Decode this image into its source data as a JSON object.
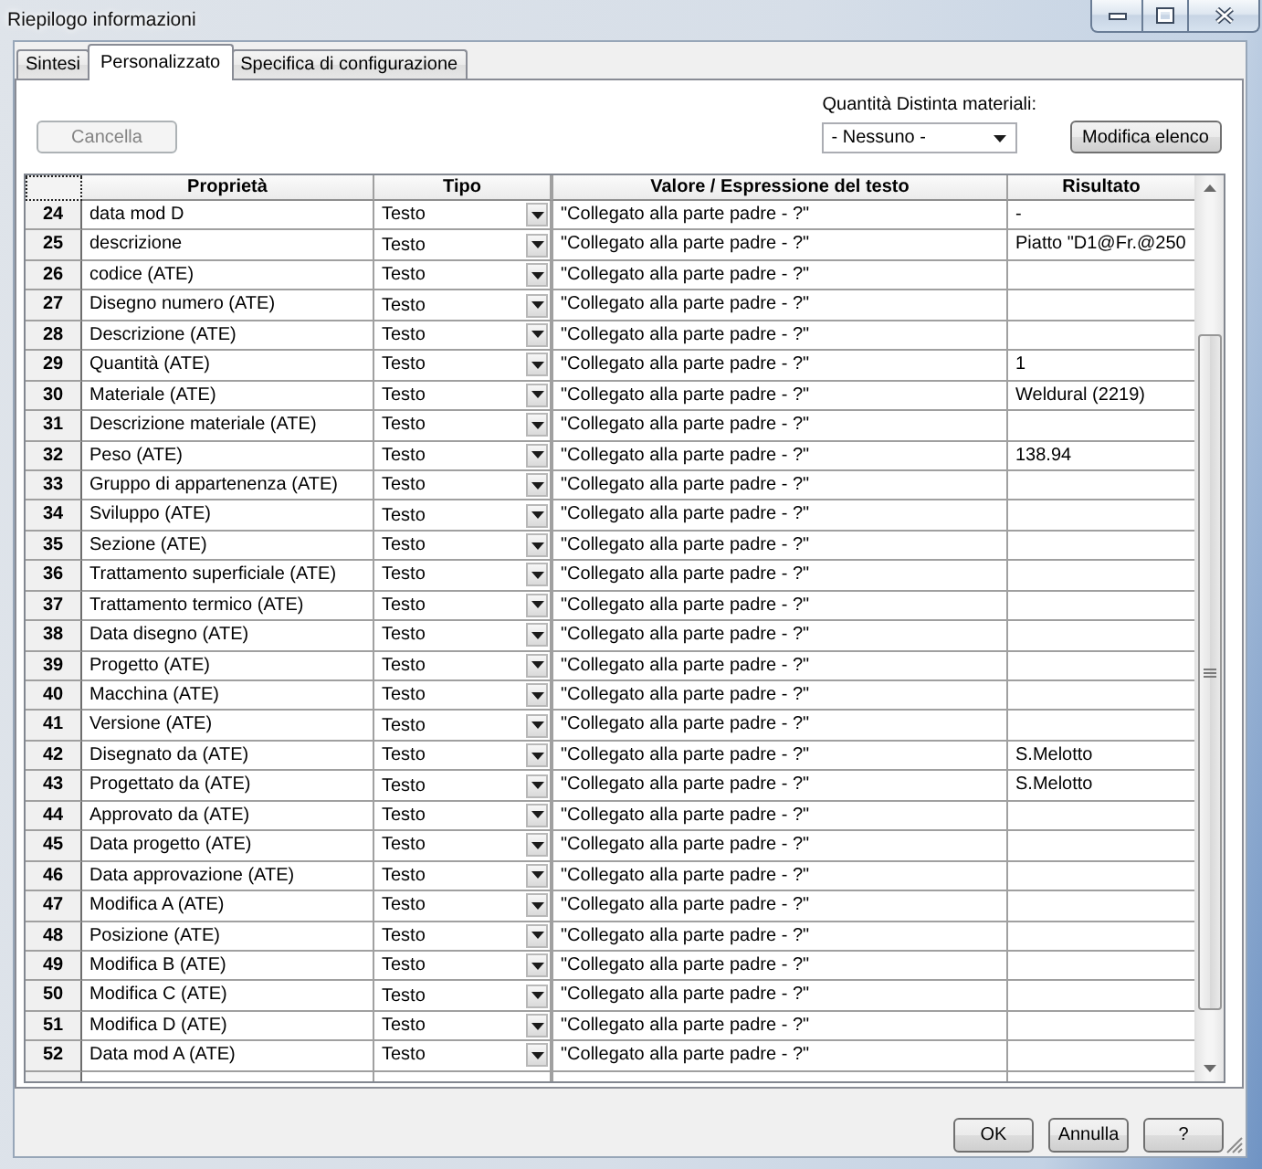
{
  "window": {
    "title": "Riepilogo informazioni"
  },
  "tabs": [
    {
      "label": "Sintesi",
      "selected": false
    },
    {
      "label": "Personalizzato",
      "selected": true
    },
    {
      "label": "Specifica di configurazione",
      "selected": false
    }
  ],
  "toolbar": {
    "delete_button": {
      "label": "Cancella",
      "disabled": true
    },
    "bom_quantity": {
      "label": "Quantità Distinta materiali:",
      "value": "- Nessuno -"
    },
    "edit_list_button": {
      "label": "Modifica elenco"
    }
  },
  "table": {
    "columns": [
      "Proprietà",
      "Tipo",
      "Valore / Espressione del testo",
      "Risultato"
    ],
    "rows": [
      {
        "number": "24",
        "property": "data mod D",
        "type": "Testo",
        "value": "\"Collegato alla parte padre - ?\"",
        "result": "-"
      },
      {
        "number": "25",
        "property": "descrizione",
        "type": "Testo",
        "value": "\"Collegato alla parte padre - ?\"",
        "result": "Piatto \"D1@Fr.@250"
      },
      {
        "number": "26",
        "property": "codice (ATE)",
        "type": "Testo",
        "value": "\"Collegato alla parte padre - ?\""
      },
      {
        "number": "27",
        "property": "Disegno numero (ATE)",
        "type": "Testo",
        "value": "\"Collegato alla parte padre - ?\""
      },
      {
        "number": "28",
        "property": "Descrizione (ATE)",
        "type": "Testo",
        "value": "\"Collegato alla parte padre - ?\""
      },
      {
        "number": "29",
        "property": "Quantità (ATE)",
        "type": "Testo",
        "value": "\"Collegato alla parte padre - ?\"",
        "result": "1"
      },
      {
        "number": "30",
        "property": "Materiale (ATE)",
        "type": "Testo",
        "value": "\"Collegato alla parte padre - ?\"",
        "result": "Weldural (2219)"
      },
      {
        "number": "31",
        "property": "Descrizione materiale (ATE)",
        "type": "Testo",
        "value": "\"Collegato alla parte padre - ?\""
      },
      {
        "number": "32",
        "property": "Peso (ATE)",
        "type": "Testo",
        "value": "\"Collegato alla parte padre - ?\"",
        "result": "138.94"
      },
      {
        "number": "33",
        "property": "Gruppo di appartenenza (ATE)",
        "type": "Testo",
        "value": "\"Collegato alla parte padre - ?\""
      },
      {
        "number": "34",
        "property": "Sviluppo (ATE)",
        "type": "Testo",
        "value": "\"Collegato alla parte padre - ?\""
      },
      {
        "number": "35",
        "property": "Sezione (ATE)",
        "type": "Testo",
        "value": "\"Collegato alla parte padre - ?\""
      },
      {
        "number": "36",
        "property": "Trattamento superficiale (ATE)",
        "type": "Testo",
        "value": "\"Collegato alla parte padre - ?\""
      },
      {
        "number": "37",
        "property": "Trattamento termico (ATE)",
        "type": "Testo",
        "value": "\"Collegato alla parte padre - ?\""
      },
      {
        "number": "38",
        "property": "Data disegno (ATE)",
        "type": "Testo",
        "value": "\"Collegato alla parte padre - ?\""
      },
      {
        "number": "39",
        "property": "Progetto (ATE)",
        "type": "Testo",
        "value": "\"Collegato alla parte padre - ?\""
      },
      {
        "number": "40",
        "property": "Macchina (ATE)",
        "type": "Testo",
        "value": "\"Collegato alla parte padre - ?\""
      },
      {
        "number": "41",
        "property": "Versione (ATE)",
        "type": "Testo",
        "value": "\"Collegato alla parte padre - ?\""
      },
      {
        "number": "42",
        "property": "Disegnato da (ATE)",
        "type": "Testo",
        "value": "\"Collegato alla parte padre - ?\"",
        "result": "S.Melotto"
      },
      {
        "number": "43",
        "property": "Progettato da (ATE)",
        "type": "Testo",
        "value": "\"Collegato alla parte padre - ?\"",
        "result": "S.Melotto"
      },
      {
        "number": "44",
        "property": "Approvato da (ATE)",
        "type": "Testo",
        "value": "\"Collegato alla parte padre - ?\""
      },
      {
        "number": "45",
        "property": "Data progetto (ATE)",
        "type": "Testo",
        "value": "\"Collegato alla parte padre - ?\""
      },
      {
        "number": "46",
        "property": "Data approvazione (ATE)",
        "type": "Testo",
        "value": "\"Collegato alla parte padre - ?\""
      },
      {
        "number": "47",
        "property": "Modifica A (ATE)",
        "type": "Testo",
        "value": "\"Collegato alla parte padre - ?\""
      },
      {
        "number": "48",
        "property": "Posizione (ATE)",
        "type": "Testo",
        "value": "\"Collegato alla parte padre - ?\""
      },
      {
        "number": "49",
        "property": "Modifica B (ATE)",
        "type": "Testo",
        "value": "\"Collegato alla parte padre - ?\""
      },
      {
        "number": "50",
        "property": "Modifica C (ATE)",
        "type": "Testo",
        "value": "\"Collegato alla parte padre - ?\""
      },
      {
        "number": "51",
        "property": "Modifica D (ATE)",
        "type": "Testo",
        "value": "\"Collegato alla parte padre - ?\""
      },
      {
        "number": "52",
        "property": "Data mod A (ATE)",
        "type": "Testo",
        "value": "\"Collegato alla parte padre - ?\""
      }
    ]
  },
  "buttons": [
    {
      "label": "OK"
    },
    {
      "label": "Annulla"
    },
    {
      "label": "?"
    }
  ]
}
